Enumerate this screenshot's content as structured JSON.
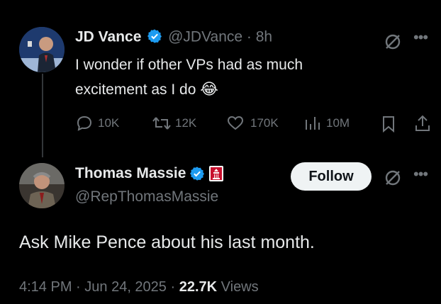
{
  "tweet1": {
    "author_name": "JD Vance",
    "handle_time": "@JDVance · 8h",
    "text_line1": "I wonder if other VPs had as much",
    "text_line2": "excitement as I do",
    "emoji": "😂",
    "stats": {
      "replies": "10K",
      "reposts": "12K",
      "likes": "170K",
      "views": "10M"
    }
  },
  "tweet2": {
    "author_name": "Thomas Massie",
    "handle": "@RepThomasMassie",
    "follow_label": "Follow",
    "text": "Ask Mike Pence about his last month.",
    "time": "4:14 PM",
    "date": "Jun 24, 2025",
    "views_count": "22.7K",
    "views_label": "Views"
  },
  "colors": {
    "background": "#000000",
    "text": "#e7e9ea",
    "muted": "#71767b",
    "verified": "#1d9bf0",
    "follow_bg": "#eff3f4"
  }
}
